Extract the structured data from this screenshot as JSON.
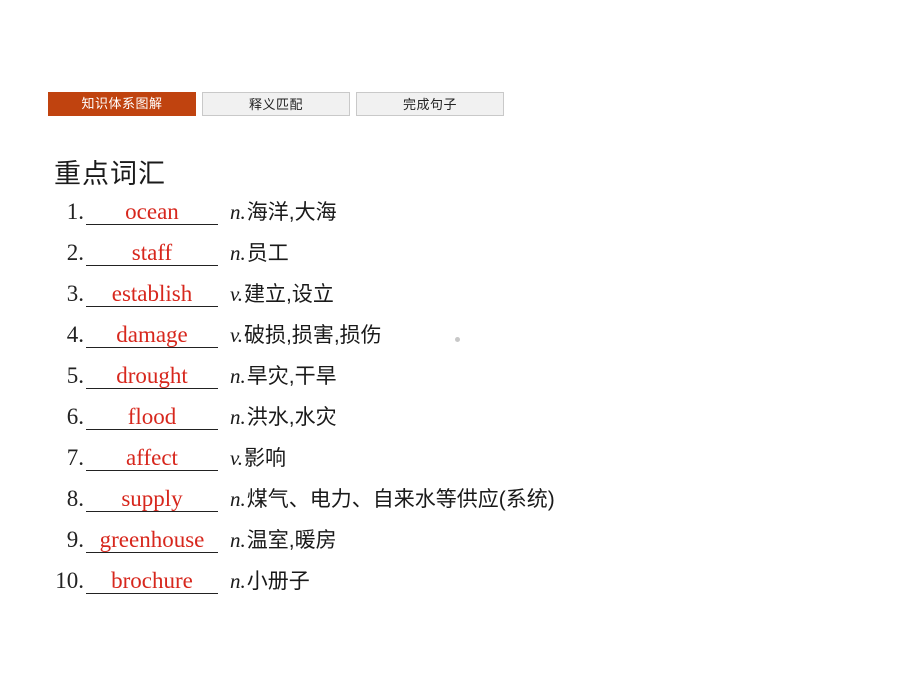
{
  "tabs": [
    {
      "label": "知识体系图解",
      "active": true
    },
    {
      "label": "释义匹配",
      "active": false
    },
    {
      "label": "完成句子",
      "active": false
    }
  ],
  "section": {
    "title": "重点词汇"
  },
  "vocabulary": [
    {
      "num": "1.",
      "answer": "ocean",
      "pos": "n.",
      "definition": "海洋,大海"
    },
    {
      "num": "2.",
      "answer": "staff",
      "pos": "n.",
      "definition": "员工"
    },
    {
      "num": "3.",
      "answer": "establish",
      "pos": "v.",
      "definition": "建立,设立"
    },
    {
      "num": "4.",
      "answer": "damage",
      "pos": "v.",
      "definition": "破损,损害,损伤"
    },
    {
      "num": "5.",
      "answer": "drought",
      "pos": "n.",
      "definition": "旱灾,干旱"
    },
    {
      "num": "6.",
      "answer": "flood",
      "pos": "n.",
      "definition": "洪水,水灾"
    },
    {
      "num": "7.",
      "answer": "affect",
      "pos": "v.",
      "definition": "影响"
    },
    {
      "num": "8.",
      "answer": "supply",
      "pos": "n.",
      "definition": "煤气、电力、自来水等供应(系统)"
    },
    {
      "num": "9.",
      "answer": "greenhouse",
      "pos": "n.",
      "definition": "温室,暖房"
    },
    {
      "num": "10.",
      "answer": "brochure",
      "pos": "n.",
      "definition": "小册子"
    }
  ],
  "colors": {
    "accent": "#c0430f",
    "answer": "#d7271d",
    "tab_idle_bg": "#f1f1f1",
    "text": "#1a1a1a"
  }
}
